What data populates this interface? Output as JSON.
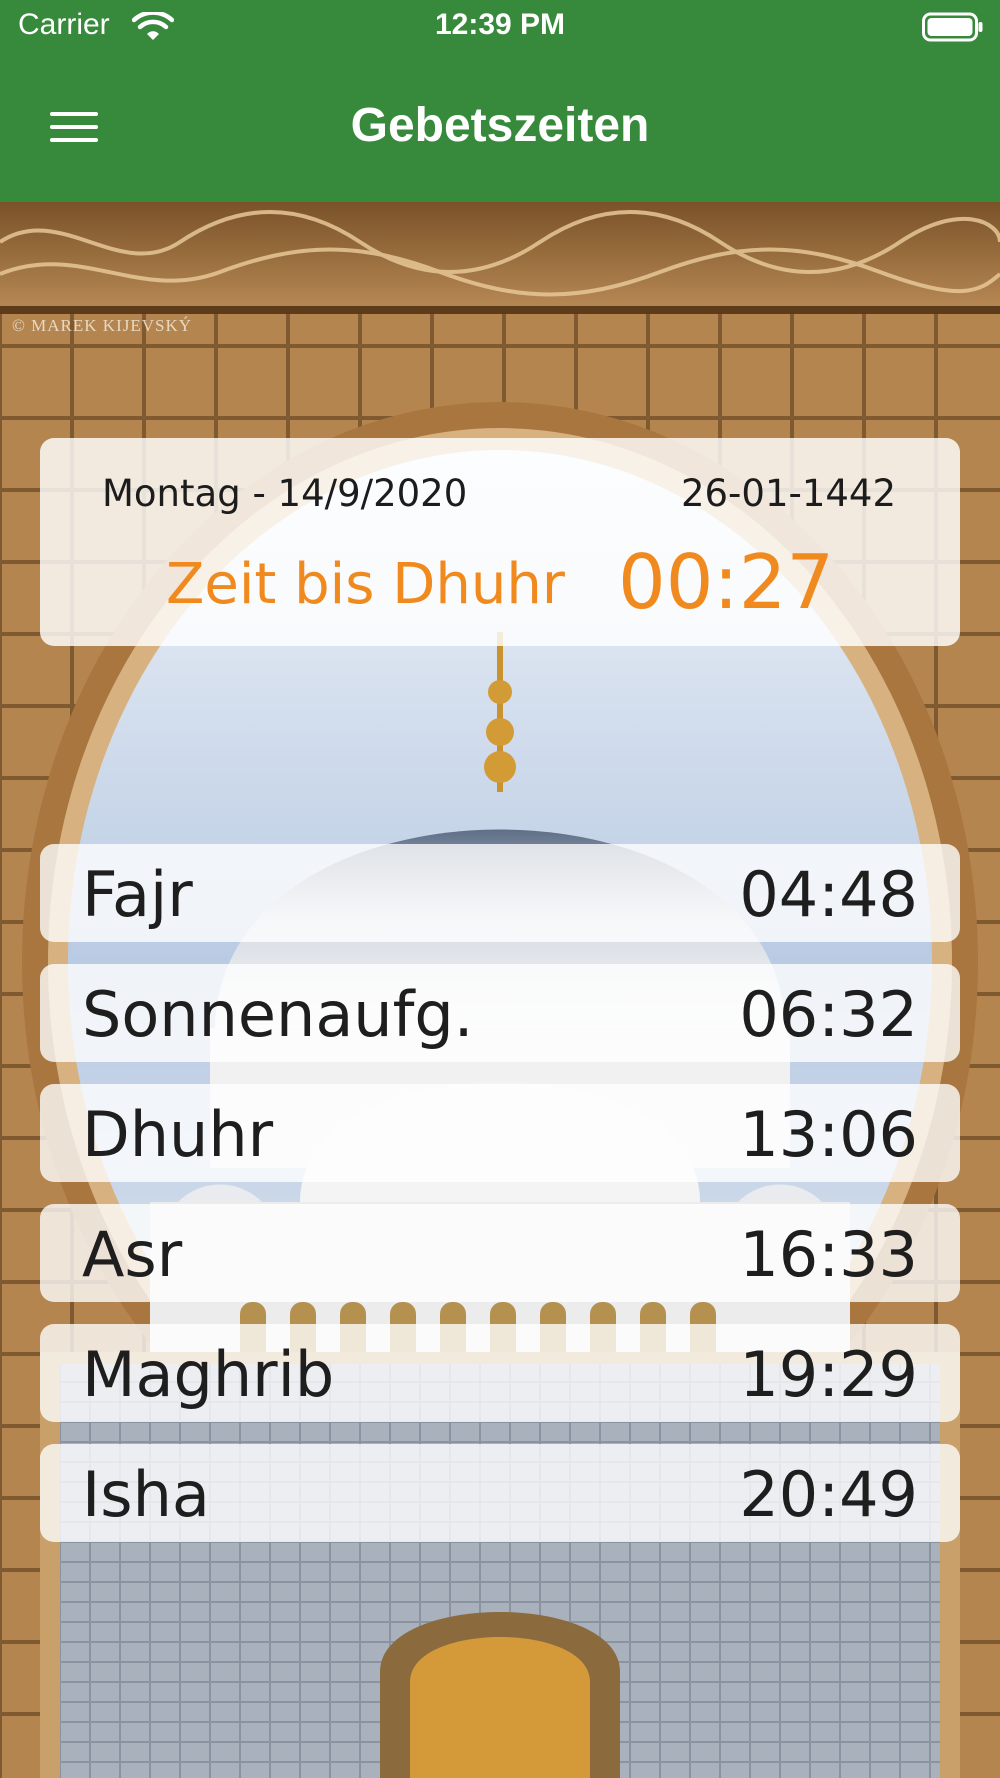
{
  "status_bar": {
    "carrier": "Carrier",
    "time": "12:39 PM",
    "icons": [
      "wifi-icon",
      "battery-icon"
    ]
  },
  "header": {
    "title": "Gebetszeiten",
    "menu_icon": "hamburger-menu-icon",
    "background_color": "#378a3b"
  },
  "background": {
    "watermark": "© MAREK KIJEVSKÝ"
  },
  "info": {
    "gregorian_date": "Montag - 14/9/2020",
    "hijri_date": "26-01-1442",
    "countdown_label": "Zeit bis Dhuhr",
    "countdown_value": "00:27",
    "accent_color": "#f08a1e"
  },
  "prayers": [
    {
      "name": "Fajr",
      "time": "04:48"
    },
    {
      "name": "Sonnenaufg.",
      "time": "06:32"
    },
    {
      "name": "Dhuhr",
      "time": "13:06"
    },
    {
      "name": "Asr",
      "time": "16:33"
    },
    {
      "name": "Maghrib",
      "time": "19:29"
    },
    {
      "name": "Isha",
      "time": "20:49"
    }
  ]
}
